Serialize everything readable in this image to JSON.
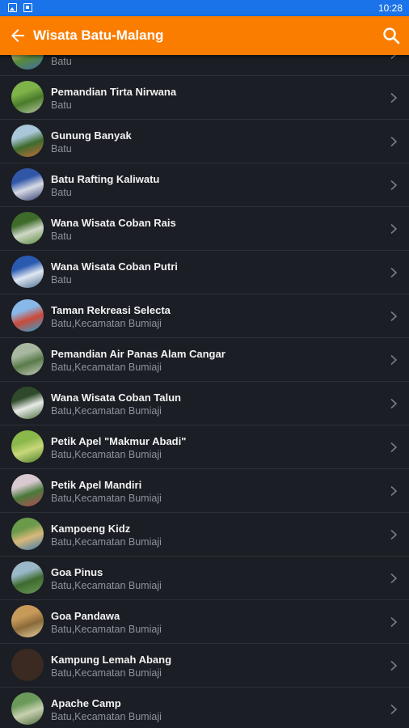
{
  "status_bar": {
    "time": "10:28"
  },
  "app_bar": {
    "title": "Wisata Batu-Malang",
    "back_icon": "arrow-back-icon",
    "search_icon": "search-icon"
  },
  "colors": {
    "app_bar": "#fb7d00",
    "status_bar": "#1a73e8",
    "background": "#1b1e24"
  },
  "items": [
    {
      "title": "",
      "subtitle": "Batu",
      "thumb": [
        "#d9c98a",
        "#5a8a3a",
        "#3b6ea8"
      ]
    },
    {
      "title": "Pemandian Tirta Nirwana",
      "subtitle": "Batu",
      "thumb": [
        "#7fb34a",
        "#4a7a2a",
        "#b8c9a0"
      ]
    },
    {
      "title": "Gunung Banyak",
      "subtitle": "Batu",
      "thumb": [
        "#a9c7d8",
        "#3e6b2e",
        "#c96b3a"
      ]
    },
    {
      "title": "Batu Rafting Kaliwatu",
      "subtitle": "Batu",
      "thumb": [
        "#3056a8",
        "#d8dbe6",
        "#2c3a6a"
      ]
    },
    {
      "title": "Wana Wisata Coban Rais",
      "subtitle": "Batu",
      "thumb": [
        "#3e6a2a",
        "#cfd8c8",
        "#5a8a3a"
      ]
    },
    {
      "title": "Wana Wisata Coban Putri",
      "subtitle": "Batu",
      "thumb": [
        "#2a5ab0",
        "#e0e8f4",
        "#4a6a8a"
      ]
    },
    {
      "title": "Taman Rekreasi Selecta",
      "subtitle": "Batu,Kecamatan Bumiaji",
      "thumb": [
        "#88b8e8",
        "#cc4a3a",
        "#2aa8d8"
      ]
    },
    {
      "title": "Pemandian Air Panas Alam Cangar",
      "subtitle": "Batu,Kecamatan Bumiaji",
      "thumb": [
        "#a8b8a0",
        "#5a7a4a",
        "#c8d0c0"
      ]
    },
    {
      "title": "Wana Wisata Coban Talun",
      "subtitle": "Batu,Kecamatan Bumiaji",
      "thumb": [
        "#2e4a2a",
        "#e8ece8",
        "#4a6a3a"
      ]
    },
    {
      "title": "Petik Apel \"Makmur Abadi\"",
      "subtitle": "Batu,Kecamatan Bumiaji",
      "thumb": [
        "#8ab84a",
        "#c8d87a",
        "#4a7a2a"
      ]
    },
    {
      "title": "Petik Apel Mandiri",
      "subtitle": "Batu,Kecamatan Bumiaji",
      "thumb": [
        "#d8c8d0",
        "#4a7a3a",
        "#b84a5a"
      ]
    },
    {
      "title": "Kampoeng Kidz",
      "subtitle": "Batu,Kecamatan Bumiaji",
      "thumb": [
        "#6a9a4a",
        "#d8b87a",
        "#3a7aa8"
      ]
    },
    {
      "title": "Goa Pinus",
      "subtitle": "Batu,Kecamatan Bumiaji",
      "thumb": [
        "#9ab8c8",
        "#3e6a2e",
        "#6a9a5a"
      ]
    },
    {
      "title": "Goa Pandawa",
      "subtitle": "Batu,Kecamatan Bumiaji",
      "thumb": [
        "#c89a5a",
        "#8a6a3a",
        "#e8d0a0"
      ]
    },
    {
      "title": "Kampung Lemah Abang",
      "subtitle": "Batu,Kecamatan Bumiaji",
      "thumb": [
        "#3a2a22",
        "#3a2a22",
        "#3a2a22"
      ]
    },
    {
      "title": "Apache Camp",
      "subtitle": "Batu,Kecamatan Bumiaji",
      "thumb": [
        "#6a9a5a",
        "#c8d0b0",
        "#4a6a3a"
      ]
    }
  ]
}
